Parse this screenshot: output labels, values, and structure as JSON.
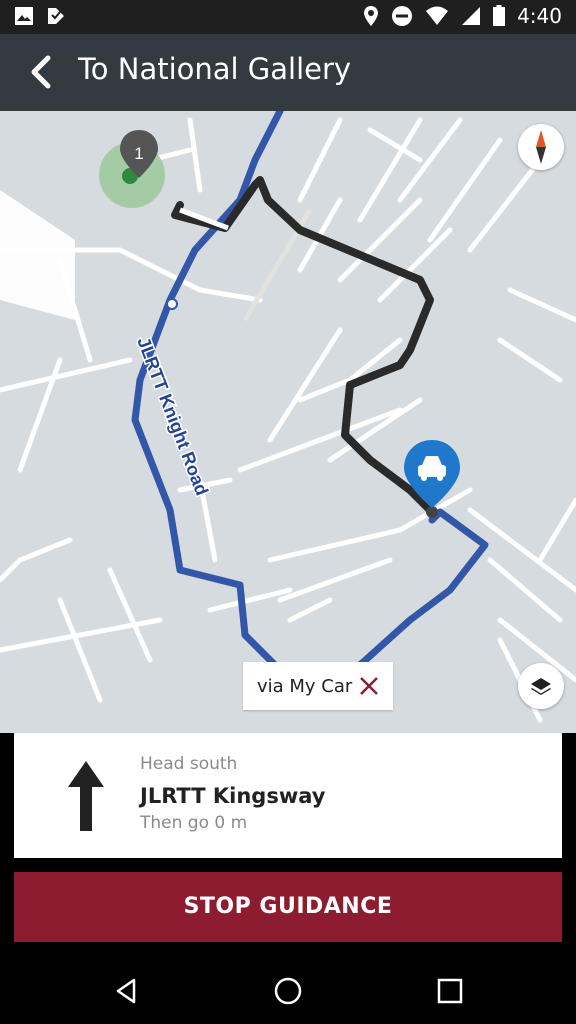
{
  "status_bar": {
    "time": "4:40"
  },
  "header": {
    "title": "To National Gallery"
  },
  "map": {
    "road_label": "JLRTT Knight Road",
    "cluster_count": "1"
  },
  "via": {
    "label": "via My Car"
  },
  "instruction": {
    "direction": "Head south",
    "street": "JLRTT Kingsway",
    "next": "Then go 0 m"
  },
  "actions": {
    "stop_label": "STOP GUIDANCE"
  },
  "colors": {
    "route_blue": "#3256a8",
    "accent": "#8e1c31",
    "appbar": "#333a40"
  },
  "icons": [
    "image-icon",
    "notification-icon",
    "location-icon",
    "dnd-icon",
    "wifi-icon",
    "signal-icon",
    "battery-icon",
    "back-arrow-icon",
    "compass-icon",
    "layers-icon",
    "car-icon",
    "close-icon",
    "straight-arrow-icon",
    "nav-back-icon",
    "nav-home-icon",
    "nav-recents-icon"
  ]
}
